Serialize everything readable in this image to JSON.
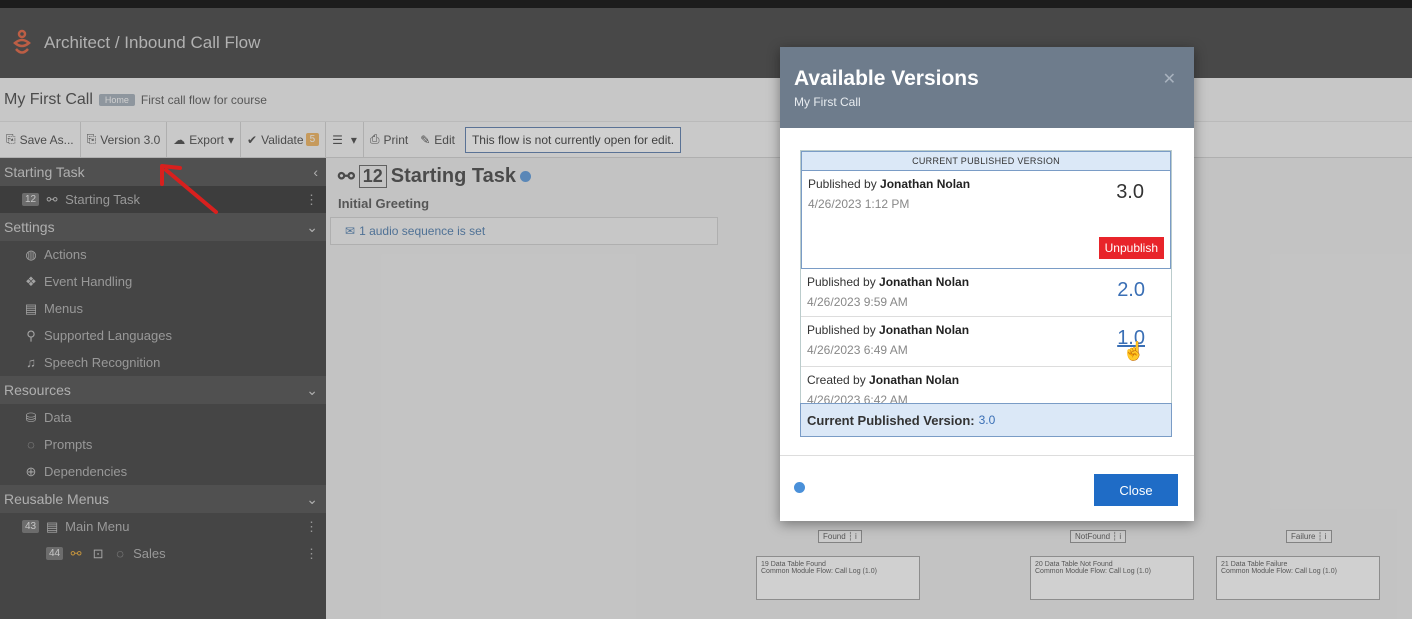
{
  "header": {
    "breadcrumb": "Architect / Inbound Call Flow",
    "flow_name": "My First Call",
    "badge": "Home",
    "flow_description": "First call flow for course"
  },
  "toolbar": {
    "save_as": "Save As...",
    "version": "Version 3.0",
    "export": "Export",
    "validate": "Validate",
    "validate_count": "5",
    "print": "Print",
    "edit": "Edit",
    "notice": "This flow is not currently open for edit."
  },
  "sidebar": {
    "starting_task_header": "Starting Task",
    "starting_task_item": "Starting Task",
    "starting_task_num": "12",
    "settings_header": "Settings",
    "settings_items": [
      "Actions",
      "Event Handling",
      "Menus",
      "Supported Languages",
      "Speech Recognition"
    ],
    "resources_header": "Resources",
    "resources_items": [
      "Data",
      "Prompts",
      "Dependencies"
    ],
    "reusable_header": "Reusable Menus",
    "main_menu": "Main Menu",
    "main_menu_num": "43",
    "sales": "Sales",
    "sales_num": "44"
  },
  "main": {
    "task_num": "12",
    "task_title": "Starting Task",
    "greeting": "Initial Greeting",
    "audio": "1 audio sequence is set"
  },
  "flow": {
    "found_label": "Found",
    "notfound_label": "NotFound",
    "failure_label": "Failure",
    "box1_title": "19 Data Table Found",
    "box1_sub": "Common Module Flow: Call Log (1.0)",
    "box2_title": "20 Data Table Not Found",
    "box2_sub": "Common Module Flow: Call Log (1.0)",
    "box3_title": "21 Data Table Failure",
    "box3_sub": "Common Module Flow: Call Log (1.0)"
  },
  "modal": {
    "title": "Available Versions",
    "subtitle": "My First Call",
    "current_header": "CURRENT PUBLISHED VERSION",
    "versions": [
      {
        "prefix": "Published by ",
        "author": "Jonathan Nolan",
        "date": "4/26/2023 1:12 PM",
        "version": "3.0"
      },
      {
        "prefix": "Published by ",
        "author": "Jonathan Nolan",
        "date": "4/26/2023 9:59 AM",
        "version": "2.0"
      },
      {
        "prefix": "Published by ",
        "author": "Jonathan Nolan",
        "date": "4/26/2023 6:49 AM",
        "version": "1.0"
      },
      {
        "prefix": "Created by ",
        "author": "Jonathan Nolan",
        "date": "4/26/2023 6:42 AM",
        "version": ""
      }
    ],
    "unpublish": "Unpublish",
    "current_version_label": "Current Published Version:",
    "current_version_value": "3.0",
    "close": "Close"
  },
  "colors": {
    "logo": "#e0502a",
    "accent_blue": "#1f6cc6",
    "unpublish_red": "#e8242a",
    "annotation_arrow": "#d8201e"
  }
}
